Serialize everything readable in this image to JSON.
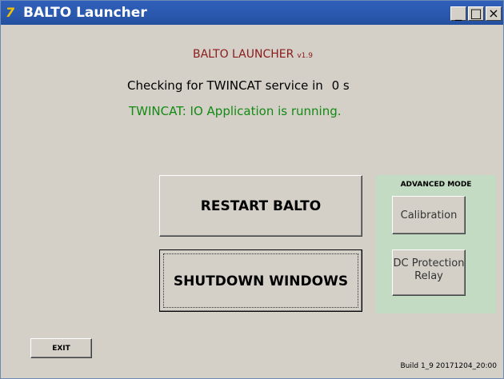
{
  "window": {
    "title": "BALTO Launcher",
    "icon": "balto-logo-icon"
  },
  "titlebar_buttons": {
    "minimize": "_",
    "maximize": "□",
    "close": "×"
  },
  "header": {
    "title": "BALTO LAUNCHER",
    "version": "v1.9"
  },
  "status": {
    "check_label": "Checking for TWINCAT service in",
    "countdown": "0 s",
    "message": "TWINCAT: IO Application is running."
  },
  "buttons": {
    "restart": "RESTART BALTO",
    "shutdown": "SHUTDOWN WINDOWS",
    "exit": "EXIT"
  },
  "advanced": {
    "title": "ADVANCED MODE",
    "calibration": "Calibration",
    "dc_relay_line1": "DC Protection",
    "dc_relay_line2": "Relay"
  },
  "footer": {
    "build": "Build 1_9 20171204_20:00"
  },
  "colors": {
    "titlebar": "#2a58ae",
    "header_title": "#8b1a1a",
    "status_ok": "#138a13",
    "advanced_panel": "#c2dbc2",
    "window_bg": "#d4d0c8"
  }
}
